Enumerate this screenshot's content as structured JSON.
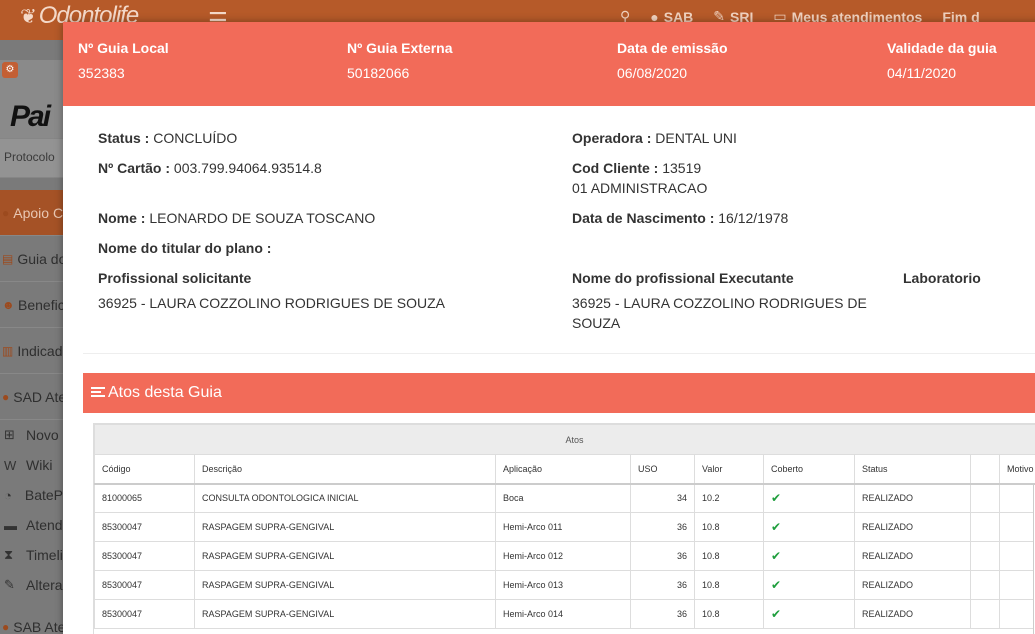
{
  "app": {
    "logo_text": "Odontolife",
    "topnav": [
      {
        "icon": "search-icon",
        "label": ""
      },
      {
        "icon": "chat-icon",
        "label": "SAB"
      },
      {
        "icon": "wrench-icon",
        "label": "SRI"
      },
      {
        "icon": "monitor-icon",
        "label": "Meus atendimentos"
      },
      {
        "icon": "",
        "label": "Fim d"
      }
    ],
    "brand_text": "Pai",
    "protocolo_placeholder": "Protocolo",
    "sidebar": [
      {
        "label": "Apoio C",
        "icon": "circle-icon",
        "highlight": true
      },
      {
        "label": "Guia do",
        "icon": "doc-icon",
        "highlight": false
      },
      {
        "label": "Benefic",
        "icon": "users-icon",
        "highlight": false
      },
      {
        "label": "Indicado",
        "icon": "chart-icon",
        "highlight": false
      },
      {
        "label": "SAD Ate",
        "icon": "circle-icon",
        "highlight": false
      }
    ],
    "sidebar_sub": [
      {
        "label": "Novo",
        "icon": "plus-icon"
      },
      {
        "label": "Wiki",
        "icon": "wiki-icon"
      },
      {
        "label": "BateP",
        "icon": "chat-icon"
      },
      {
        "label": "Atend",
        "icon": "monitor-icon"
      },
      {
        "label": "Timeli",
        "icon": "hourglass-icon"
      },
      {
        "label": "Altera",
        "icon": "pencil-icon"
      }
    ],
    "sidebar_bottom": "SAB Ate"
  },
  "header": {
    "cols": [
      {
        "label": "Nº Guia Local",
        "value": "352383"
      },
      {
        "label": "Nº Guia Externa",
        "value": "50182066"
      },
      {
        "label": "Data de emissão",
        "value": "06/08/2020"
      },
      {
        "label": "Validade da guia",
        "value": "04/11/2020"
      }
    ]
  },
  "info": {
    "status_label": "Status :",
    "status_value": "CONCLUÍDO",
    "operadora_label": "Operadora :",
    "operadora_value": "DENTAL UNI",
    "cartao_label": "Nº Cartão :",
    "cartao_value": "003.799.94064.93514.8",
    "cod_cliente_label": "Cod Cliente :",
    "cod_cliente_value": "13519",
    "cod_cliente_value2": "01 ADMINISTRACAO",
    "nome_label": "Nome :",
    "nome_value": "LEONARDO DE SOUZA TOSCANO",
    "nascimento_label": "Data de Nascimento :",
    "nascimento_value": "16/12/1978",
    "titular_label": "Nome do titular do plano :",
    "solicitante_label": "Profissional solicitante",
    "solicitante_value": "36925 - LAURA COZZOLINO RODRIGUES DE SOUZA",
    "executante_label": "Nome do profissional Executante",
    "executante_value_line1": "36925 - LAURA COZZOLINO RODRIGUES DE",
    "executante_value_line2": "SOUZA",
    "laboratorio_label": "Laboratorio"
  },
  "atos": {
    "title": "Atos desta Guia",
    "group_header": "Atos",
    "columns": [
      "Código",
      "Descrição",
      "Aplicação",
      "USO",
      "Valor",
      "Coberto",
      "Status",
      "",
      "Motivo"
    ],
    "rows": [
      {
        "codigo": "81000065",
        "descricao": "CONSULTA ODONTOLOGICA INICIAL",
        "aplicacao": "Boca",
        "uso": "34",
        "valor": "10.2",
        "coberto": "✔",
        "status": "REALIZADO"
      },
      {
        "codigo": "85300047",
        "descricao": "RASPAGEM SUPRA-GENGIVAL",
        "aplicacao": "Hemi-Arco 011",
        "uso": "36",
        "valor": "10.8",
        "coberto": "✔",
        "status": "REALIZADO"
      },
      {
        "codigo": "85300047",
        "descricao": "RASPAGEM SUPRA-GENGIVAL",
        "aplicacao": "Hemi-Arco 012",
        "uso": "36",
        "valor": "10.8",
        "coberto": "✔",
        "status": "REALIZADO"
      },
      {
        "codigo": "85300047",
        "descricao": "RASPAGEM SUPRA-GENGIVAL",
        "aplicacao": "Hemi-Arco 013",
        "uso": "36",
        "valor": "10.8",
        "coberto": "✔",
        "status": "REALIZADO"
      },
      {
        "codigo": "85300047",
        "descricao": "RASPAGEM SUPRA-GENGIVAL",
        "aplicacao": "Hemi-Arco 014",
        "uso": "36",
        "valor": "10.8",
        "coberto": "✔",
        "status": "REALIZADO"
      }
    ]
  }
}
